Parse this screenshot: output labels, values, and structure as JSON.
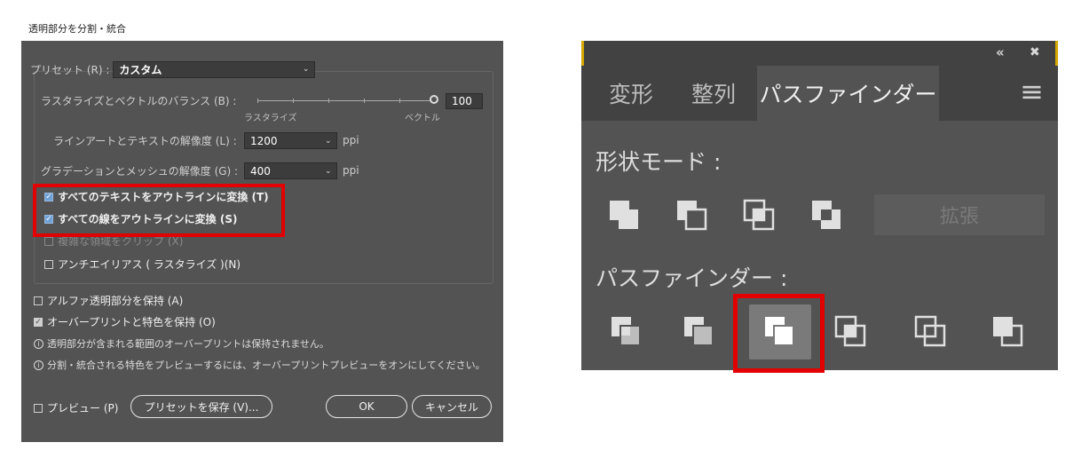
{
  "dialog": {
    "title": "透明部分を分割・統合",
    "preset_label": "プリセット (R) :",
    "preset_value": "カスタム",
    "raster_vector_label": "ラスタライズとベクトルのバランス (B) :",
    "raster_vector_value": "100",
    "raster_label": "ラスタライズ",
    "vector_label": "ベクトル",
    "line_art_label": "ラインアートとテキストの解像度 (L) :",
    "line_art_value": "1200",
    "gradient_label": "グラデーションとメッシュの解像度 (G) :",
    "gradient_value": "400",
    "unit_ppi": "ppi",
    "checkboxes": [
      {
        "label": "すべてのテキストをアウトラインに変換 (T)",
        "checked": true
      },
      {
        "label": "すべての線をアウトラインに変換 (S)",
        "checked": true
      },
      {
        "label": "複雑な領域をクリップ (X)",
        "checked": false
      },
      {
        "label": "アンチエイリアス ( ラスタライズ )(N)",
        "checked": false
      }
    ],
    "alpha_label": "アルファ透明部分を保持 (A)",
    "overprint_label": "オーバープリントと特色を保持 (O)",
    "info1": "透明部分が含まれる範囲のオーバープリントは保持されません。",
    "info2": "分割・統合される特色をプレビューするには、オーバープリントプレビューをオンにしてください。",
    "preview_label": "プレビュー (P)",
    "save_preset_button": "プリセットを保存 (V)...",
    "ok_button": "OK",
    "cancel_button": "キャンセル",
    "check_blue": "#6fa0d6",
    "highlight_red": "#e30000"
  },
  "panel": {
    "collapse_glyph": "«",
    "close_glyph": "✖",
    "tabs": [
      "変形",
      "整列",
      "パスファインダー"
    ],
    "active_tab": "パスファインダー",
    "menu_glyph": "≡",
    "shape_modes_label": "形状モード :",
    "expand_button": "拡張",
    "pathfinders_label": "パスファインダー :",
    "shape_mode_icons": [
      "unite-icon",
      "minus-front-icon",
      "intersect-icon",
      "exclude-icon"
    ],
    "pathfinder_icons": [
      "divide-icon",
      "trim-icon",
      "merge-icon",
      "crop-icon",
      "outline-icon",
      "minus-back-icon"
    ],
    "selected_pathfinder": "merge-icon"
  }
}
